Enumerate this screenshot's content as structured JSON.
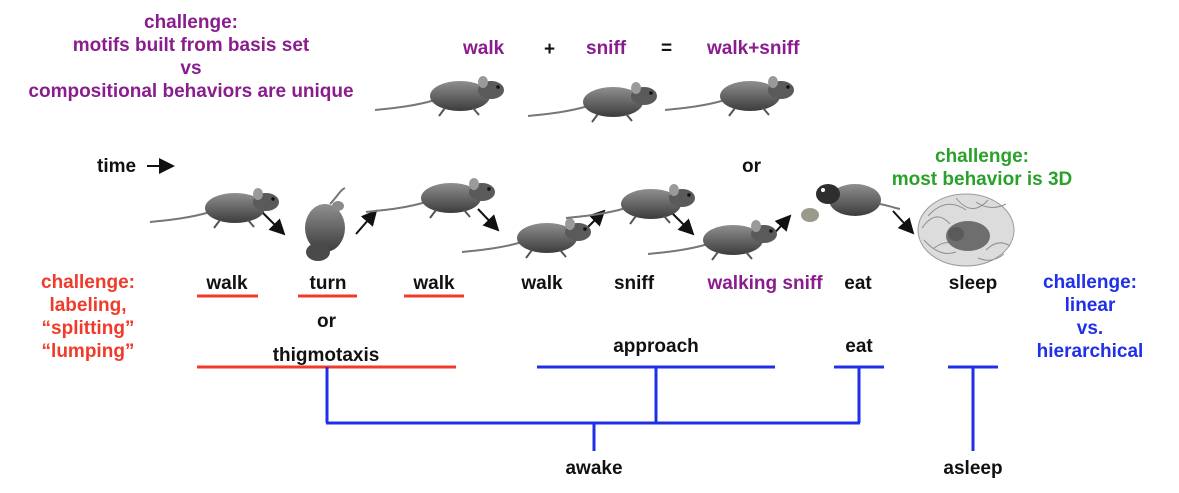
{
  "colors": {
    "purple": "#8a1d8e",
    "green": "#2aa12a",
    "red": "#f03a2a",
    "blue": "#2030e8",
    "black": "#111111"
  },
  "challenges": {
    "motifs": [
      "challenge:",
      "motifs built from basis set",
      "vs",
      "compositional behaviors are unique"
    ],
    "three_d": [
      "challenge:",
      "most behavior is 3D"
    ],
    "labeling": [
      "challenge:",
      "labeling,",
      "“splitting”",
      "“lumping”"
    ],
    "hierarchy": [
      "challenge:",
      "linear",
      "vs.",
      "hierarchical"
    ]
  },
  "equation": {
    "term1": "walk",
    "plus": "+",
    "term2": "sniff",
    "equals": "=",
    "result": "walk+sniff"
  },
  "time_label": "time",
  "or_top": "or",
  "or_mid": "or",
  "sequence": [
    "walk",
    "turn",
    "walk",
    "walk",
    "sniff",
    "walking sniff",
    "eat",
    "sleep"
  ],
  "hierarchy": {
    "level1": [
      "thigmotaxis",
      "approach",
      "eat"
    ],
    "level2": [
      "awake",
      "asleep"
    ]
  },
  "icons": [
    "time-arrow-icon",
    "transition-arrow-icon",
    "mouse-illustration",
    "sleeping-mouse-nest"
  ]
}
